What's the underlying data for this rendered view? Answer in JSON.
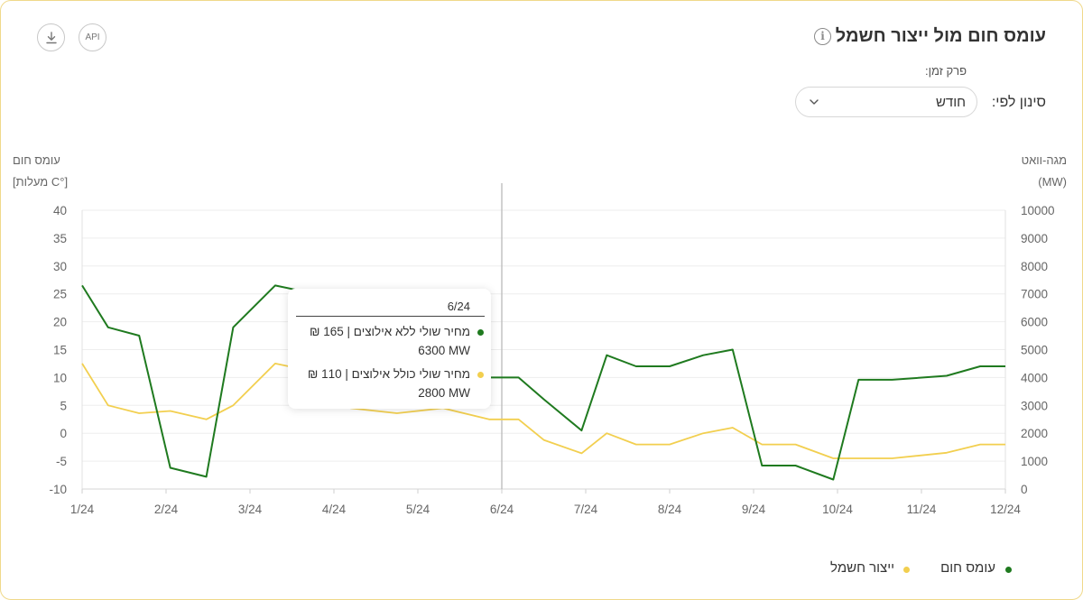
{
  "header": {
    "title": "עומס חום מול ייצור חשמל",
    "download_icon": "download-icon",
    "api_label": "API",
    "info_icon": "info-icon",
    "info_glyph": "i"
  },
  "filters": {
    "period_label": "פרק זמן:",
    "filter_label": "סינון לפי:",
    "selected": "חודש"
  },
  "tooltip": {
    "title": "6/24",
    "rows": [
      {
        "label": "מחיר שולי ללא אילוצים | 165 ₪",
        "value": "6300 MW",
        "color": "#1f7a1f"
      },
      {
        "label": "מחיר שולי כולל אילוצים | 110 ₪",
        "value": "2800 MW",
        "color": "#f2cf4f"
      }
    ]
  },
  "legend": [
    {
      "label": "עומס חום",
      "color": "#1f7a1f"
    },
    {
      "label": "ייצור חשמל",
      "color": "#f2cf4f"
    }
  ],
  "chart_data": {
    "type": "line",
    "left_axis": {
      "title_line1": "עומס חום",
      "title_line2": "[מעלות C°]",
      "ylim": [
        -10,
        40
      ],
      "ticks": [
        -10,
        -5,
        0,
        5,
        10,
        15,
        20,
        25,
        30,
        35,
        40
      ]
    },
    "right_axis": {
      "title_line1": "מגה-וואט",
      "title_line2": "(MW)",
      "ylim": [
        0,
        10000
      ],
      "ticks": [
        0,
        1000,
        2000,
        3000,
        4000,
        5000,
        6000,
        7000,
        8000,
        9000,
        10000
      ]
    },
    "x_tick_labels": [
      "1/24",
      "2/24",
      "3/24",
      "4/24",
      "5/24",
      "6/24",
      "7/24",
      "8/24",
      "9/24",
      "10/24",
      "11/24",
      "12/24"
    ],
    "xlim": [
      0,
      11
    ],
    "crosshair_x": 5,
    "grid": true,
    "legend_position": "bottom",
    "series": [
      {
        "name": "עומס חום",
        "axis": "left",
        "color": "#1f7a1f",
        "x": [
          0,
          0.31,
          0.68,
          1.05,
          1.48,
          1.8,
          2.3,
          2.78,
          3.2,
          3.75,
          4.3,
          4.85,
          5.2,
          5.5,
          5.95,
          6.25,
          6.6,
          7.0,
          7.4,
          7.75,
          8.1,
          8.5,
          8.95,
          9.25,
          9.65,
          10.3,
          10.7,
          11
        ],
        "values": [
          26.5,
          19,
          17.5,
          -6.2,
          -7.8,
          19,
          26.5,
          25,
          20,
          19,
          20,
          10,
          10,
          6.1,
          0.5,
          14,
          12,
          12,
          14,
          15,
          -5.8,
          -5.8,
          -8.3,
          9.6,
          9.6,
          10.3,
          12,
          12
        ]
      },
      {
        "name": "ייצור חשמל",
        "axis": "left",
        "color": "#f2cf4f",
        "x": [
          0,
          0.31,
          0.68,
          1.05,
          1.48,
          1.8,
          2.3,
          2.78,
          3.2,
          3.75,
          4.3,
          4.85,
          5.2,
          5.5,
          5.95,
          6.25,
          6.6,
          7.0,
          7.4,
          7.75,
          8.1,
          8.5,
          8.95,
          9.25,
          9.65,
          10.3,
          10.7,
          11
        ],
        "values": [
          12.5,
          5,
          3.6,
          4,
          2.5,
          5,
          12.5,
          11,
          4.5,
          3.6,
          4.5,
          2.5,
          2.5,
          -1.2,
          -3.6,
          0,
          -2,
          -2,
          0,
          1,
          -2,
          -2,
          -4.5,
          -4.5,
          -4.5,
          -3.5,
          -2,
          -2
        ]
      }
    ]
  }
}
